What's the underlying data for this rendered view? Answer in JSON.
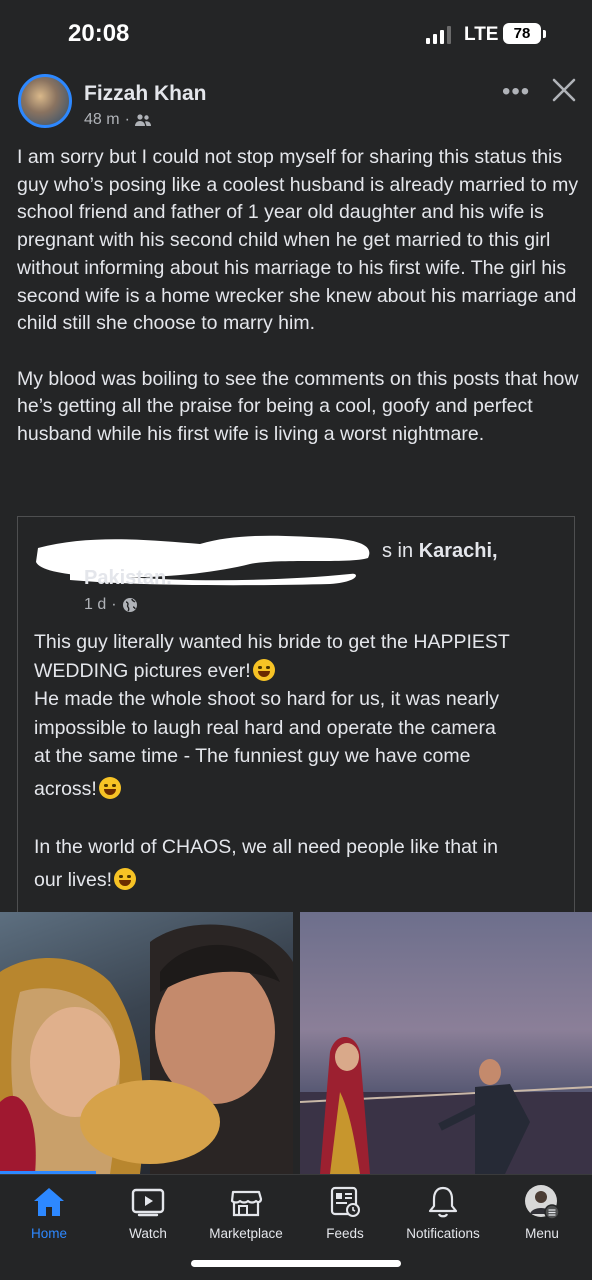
{
  "status_bar": {
    "time": "20:08",
    "network": "LTE",
    "battery": "78"
  },
  "post": {
    "author": "Fizzah Khan",
    "time": "48 m",
    "separator": "·",
    "paragraphs": [
      "I am sorry but I could not stop myself for sharing this status this guy who’s posing like a coolest husband is already married to my school friend and father of 1 year old daughter and his wife is pregnant with his second child when he get married to this girl without informing about his marriage to his first wife. The girl his second wife is a home wrecker she knew about his marriage and child still she choose to marry him.",
      "My blood was boiling to see the comments on this posts that how he’s getting all the praise for being a cool, goofy and perfect husband while his first wife is living a worst nightmare."
    ]
  },
  "shared_post": {
    "header_tail_prefix": "s in ",
    "header_location_1": "Karachi,",
    "header_location_2": "Pakistan.",
    "time": "1 d",
    "separator": "·",
    "lines": [
      "This guy literally wanted his bride to get the HAPPIEST",
      "WEDDING pictures ever!",
      "He made the whole shoot so hard for us, it was nearly",
      "impossible to laugh real hard and operate the camera",
      "at the same time  - The funniest guy we have come",
      "across!",
      "In the world of CHAOS, we all need people like that in",
      "our lives!"
    ]
  },
  "bottom_nav": {
    "items": [
      {
        "label": "Home",
        "icon": "home-icon",
        "active": true
      },
      {
        "label": "Watch",
        "icon": "watch-icon"
      },
      {
        "label": "Marketplace",
        "icon": "marketplace-icon"
      },
      {
        "label": "Feeds",
        "icon": "feeds-icon"
      },
      {
        "label": "Notifications",
        "icon": "bell-icon"
      },
      {
        "label": "Menu",
        "icon": "menu-avatar-icon"
      }
    ]
  },
  "colors": {
    "background": "#242526",
    "accent": "#2d88ff",
    "text": "#e4e6eb",
    "secondary_text": "#b0b3b8"
  }
}
